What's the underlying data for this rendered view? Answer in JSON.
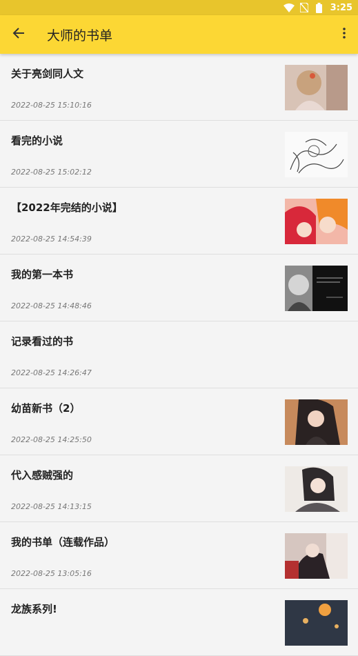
{
  "status_bar": {
    "time": "3:25"
  },
  "app_bar": {
    "title": "大师的书单"
  },
  "items": [
    {
      "name": "关于亮剑同人文",
      "date": "2022-08-25 15:10:16",
      "thumb": "portrait-girl-illustration"
    },
    {
      "name": "看完的小说",
      "date": "2022-08-25 15:02:12",
      "thumb": "line-sketch-illustration"
    },
    {
      "name": "【2022年完结的小说】",
      "date": "2022-08-25 14:54:39",
      "thumb": "anime-couple-illustration"
    },
    {
      "name": "我的第一本书",
      "date": "2022-08-25 14:48:46",
      "thumb": "quote-meme-image"
    },
    {
      "name": "记录看过的书",
      "date": "2022-08-25 14:26:47",
      "thumb": null
    },
    {
      "name": "幼苗新书（2）",
      "date": "2022-08-25 14:25:50",
      "thumb": "anime-girl-dark-hair"
    },
    {
      "name": "代入感贼强的",
      "date": "2022-08-25 14:13:15",
      "thumb": "anime-boy-illustration"
    },
    {
      "name": "我的书单（连载作品）",
      "date": "2022-08-25 13:05:16",
      "thumb": "anime-dark-coat-illustration"
    },
    {
      "name": "龙族系列!",
      "date": "",
      "thumb": "night-lights-image"
    }
  ]
}
